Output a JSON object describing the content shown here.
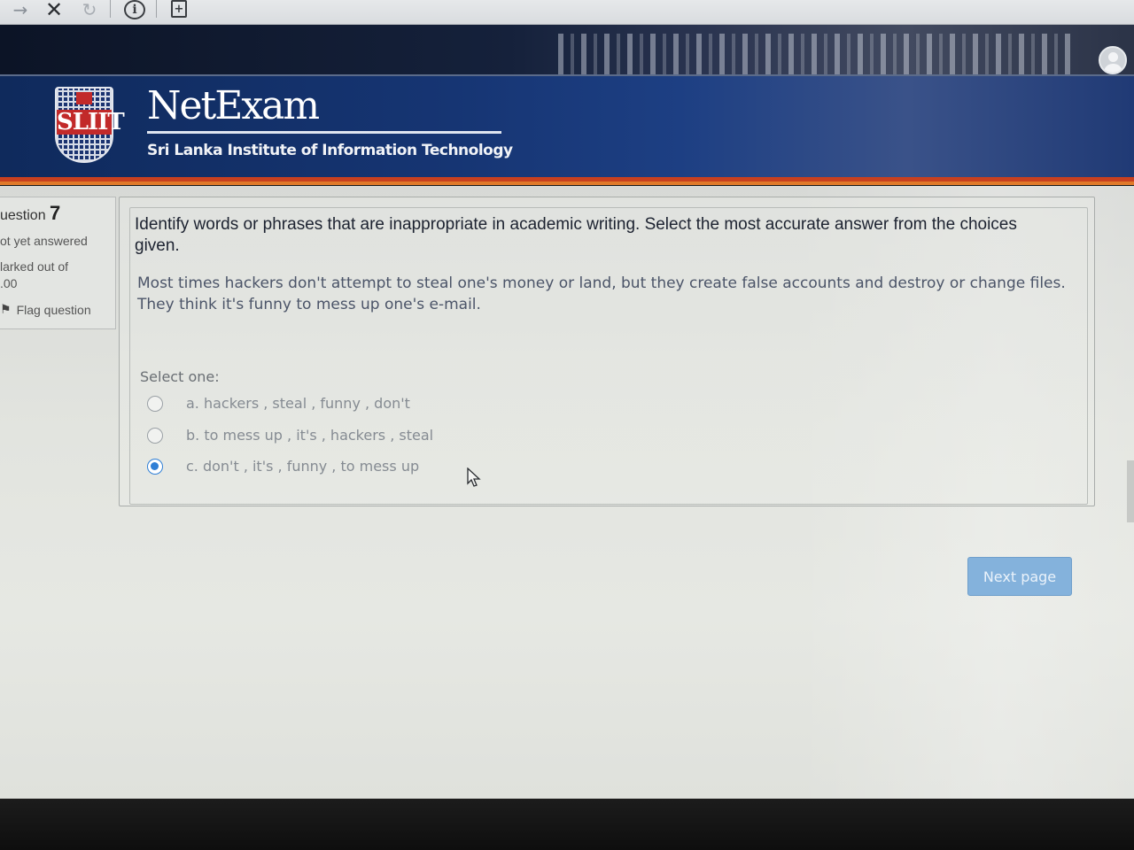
{
  "browser": {
    "back_glyph": "→",
    "close_glyph": "✕",
    "reload_glyph": "↻",
    "info_glyph": "i",
    "page_glyph": "+"
  },
  "header": {
    "brand": "NetExam",
    "subtitle": "Sri Lanka Institute of Information Technology",
    "logo_text": "SLIIT"
  },
  "question_info": {
    "label": "uestion",
    "number": "7",
    "state": "ot yet answered",
    "marked_label": "larked out of",
    "mark": ".00",
    "flag_label": "Flag question"
  },
  "question": {
    "prompt": "Identify words or phrases that are inappropriate in academic writing. Select the most accurate answer from the choices given.",
    "passage": "Most times hackers don't attempt to steal one's money or land, but they create false accounts and destroy or change files. They think it's funny to mess up one's e-mail.",
    "select_label": "Select one:",
    "options": [
      {
        "label": "a. hackers , steal , funny , don't",
        "selected": false
      },
      {
        "label": "b. to mess up , it's , hackers , steal",
        "selected": false
      },
      {
        "label": "c. don't , it's , funny , to mess up",
        "selected": true
      }
    ]
  },
  "navigation": {
    "next_label": "Next page"
  },
  "colors": {
    "header_blue": "#163573",
    "accent_red": "#c8401f",
    "radio_selected": "#2f7fd6",
    "button_blue": "#84b2dc"
  },
  "icons": {
    "back": "back-arrow-icon",
    "close": "close-icon",
    "reload": "reload-icon",
    "info": "info-icon",
    "page": "page-icon",
    "avatar": "user-avatar-icon",
    "flag": "flag-icon",
    "cursor": "mouse-cursor-icon"
  }
}
